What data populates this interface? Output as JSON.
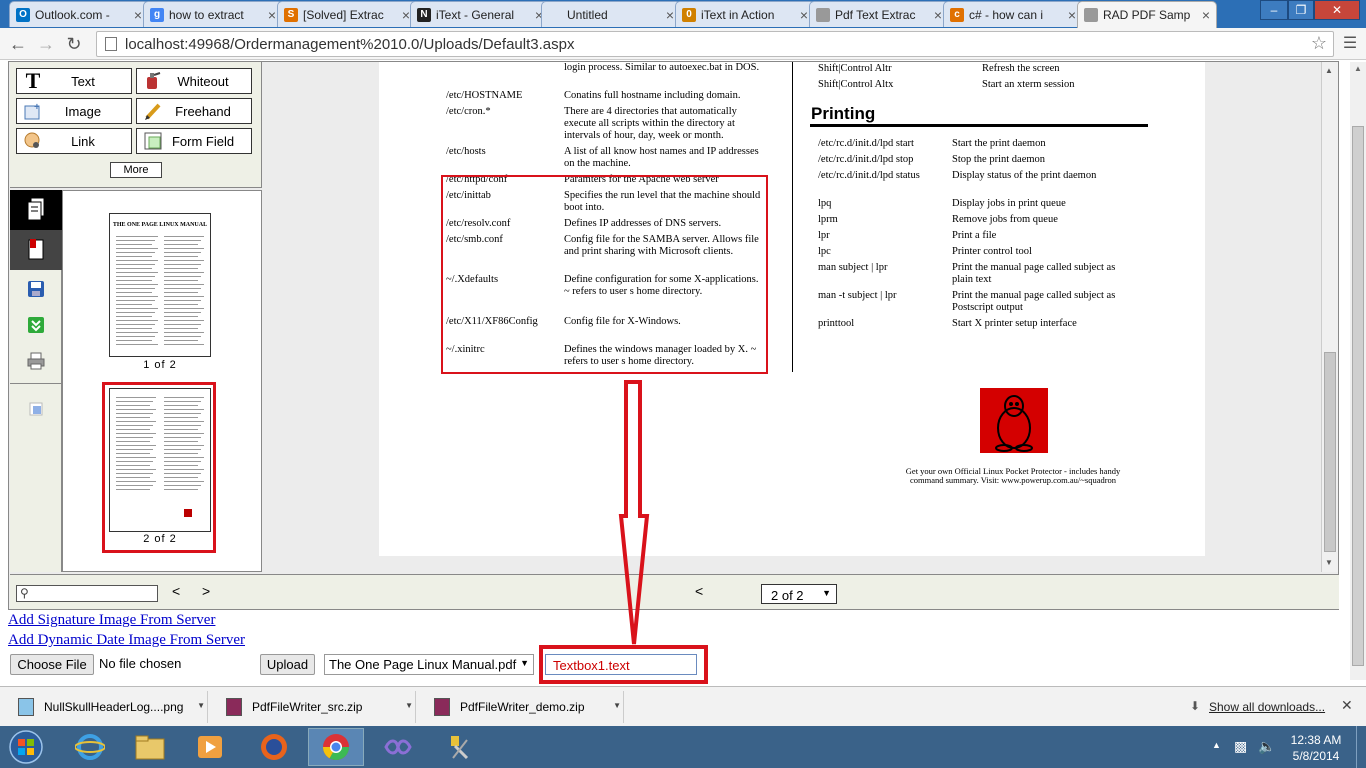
{
  "browser": {
    "tabs": [
      {
        "title": "Outlook.com -",
        "icon": "outlook-icon",
        "color": "#0072c6",
        "glyph": "O"
      },
      {
        "title": "how to extract",
        "icon": "google-icon",
        "color": "#4285f4",
        "glyph": "g"
      },
      {
        "title": "[Solved] Extrac",
        "icon": "codeproject-icon",
        "color": "#e07000",
        "glyph": "S"
      },
      {
        "title": "iText - General",
        "icon": "itext-n-icon",
        "color": "#222222",
        "glyph": "N"
      },
      {
        "title": "Untitled",
        "icon": "",
        "color": "",
        "glyph": ""
      },
      {
        "title": "iText in Action",
        "icon": "itext-icon",
        "color": "#d08000",
        "glyph": "0"
      },
      {
        "title": "Pdf Text Extrac",
        "icon": "pdf-page-icon",
        "color": "#999999",
        "glyph": ""
      },
      {
        "title": "c# - how can i",
        "icon": "stackoverflow-icon",
        "color": "#e07000",
        "glyph": "c"
      },
      {
        "title": "RAD PDF Samp",
        "icon": "page-icon",
        "color": "#999999",
        "glyph": ""
      }
    ],
    "url": "localhost:49968/Ordermanagement%2010.0/Uploads/Default3.aspx"
  },
  "tools": {
    "text": "Text",
    "whiteout": "Whiteout",
    "image": "Image",
    "freehand": "Freehand",
    "link": "Link",
    "form_field": "Form Field",
    "more": "More"
  },
  "thumbnails": {
    "page1_caption": "1 of 2",
    "page2_caption": "2 of 2",
    "page1_title": "THE ONE PAGE LINUX MANUAL"
  },
  "pdf": {
    "left_rows": [
      {
        "c1": "",
        "c2": "login process. Similar to autoexec.bat in DOS."
      },
      {
        "c1": "/etc/HOSTNAME",
        "c2": "Conatins full hostname including domain."
      },
      {
        "c1": "/etc/cron.*",
        "c2": "There are 4 directories that automatically execute all scripts within the directory at intervals of hour, day, week or month."
      },
      {
        "c1": "/etc/hosts",
        "c2": "A list of all know host names and IP addresses on the machine."
      },
      {
        "c1": "/etc/httpd/conf",
        "c2": "Paramters for the Apache web server"
      },
      {
        "c1": "/etc/inittab",
        "c2": "Specifies the run level that the machine should boot into."
      },
      {
        "c1": "/etc/resolv.conf",
        "c2": "Defines IP addresses of DNS servers."
      },
      {
        "c1": "/etc/smb.conf",
        "c2": "Config file for the SAMBA server. Allows file and print sharing with Microsoft clients."
      },
      {
        "c1": "~/.Xdefaults",
        "c2": "Define configuration for some X-applications. ~ refers to user s home directory."
      },
      {
        "c1": "/etc/X11/XF86Config",
        "c2": "Config file for X-Windows."
      },
      {
        "c1": "~/.xinitrc",
        "c2": "Defines the windows manager loaded by X. ~ refers to user s home directory."
      }
    ],
    "right_top_rows": [
      {
        "c1": "Shift|Control Altr",
        "c2": "Refresh the screen"
      },
      {
        "c1": "Shift|Control Altx",
        "c2": "Start an xterm session"
      }
    ],
    "printing_heading": "Printing",
    "printing_rows": [
      {
        "c1": "/etc/rc.d/init.d/lpd start",
        "c2": "Start the print daemon"
      },
      {
        "c1": "/etc/rc.d/init.d/lpd stop",
        "c2": "Stop the print daemon"
      },
      {
        "c1": "/etc/rc.d/init.d/lpd status",
        "c2": "Display status of the print daemon"
      },
      {
        "c1": "lpq",
        "c2": "Display jobs in print queue"
      },
      {
        "c1": "lprm",
        "c2": "Remove jobs from queue"
      },
      {
        "c1": "lpr",
        "c2": "Print a file"
      },
      {
        "c1": "lpc",
        "c2": "Printer control tool"
      },
      {
        "c1": "man subject | lpr",
        "c2": "Print the manual page called subject as plain text"
      },
      {
        "c1": "man -t subject | lpr",
        "c2": "Print the manual page called subject as Postscript output"
      },
      {
        "c1": "printtool",
        "c2": "Start X printer setup interface"
      }
    ],
    "footer_text": "Get your own Official Linux Pocket Protector - includes handy command summary. Visit: www.powerup.com.au/~squadron"
  },
  "nav": {
    "prev": "<",
    "next": ">",
    "page_prev": "<",
    "page_select": "2 of 2"
  },
  "form": {
    "link_signature": "Add Signature Image From Server",
    "link_date": "Add Dynamic Date Image From Server",
    "choose_file": "Choose File",
    "no_file": "No file chosen",
    "upload": "Upload",
    "file_select": "The One Page Linux Manual.pdf",
    "textbox_value": "Textbox1.text"
  },
  "downloads": {
    "items": [
      {
        "name": "NullSkullHeaderLog....png"
      },
      {
        "name": "PdfFileWriter_src.zip"
      },
      {
        "name": "PdfFileWriter_demo.zip"
      }
    ],
    "show_all": "Show all downloads..."
  },
  "taskbar": {
    "time": "12:38 AM",
    "date": "5/8/2014"
  },
  "colors": {
    "annotation_red": "#d9121b",
    "tab_strip": "#2c6fb6",
    "taskbar": "#3a6289"
  }
}
